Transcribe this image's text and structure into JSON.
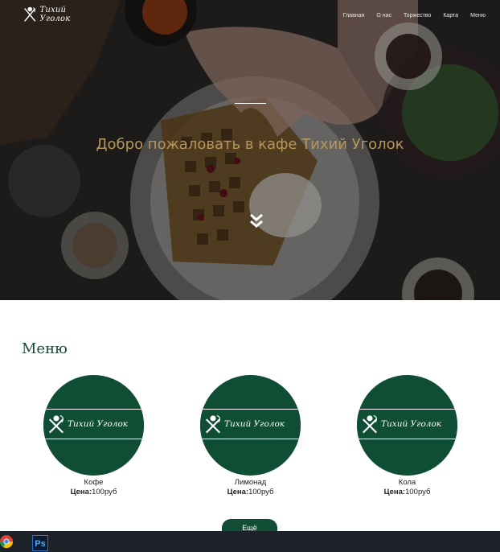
{
  "header": {
    "logo_text": "Тихий Уголок",
    "nav": [
      "Главная",
      "О нас",
      "Торжество",
      "Карта",
      "Меню"
    ]
  },
  "hero": {
    "title": "Добро пожаловать в кафе Тихий Уголок"
  },
  "menu": {
    "title": "Меню",
    "items": [
      {
        "name": "Кофе",
        "price_label": "Цена:",
        "price": "100руб",
        "logo_text": "Тихий Уголок"
      },
      {
        "name": "Лимонад",
        "price_label": "Цена:",
        "price": "100руб",
        "logo_text": "Тихий Уголок"
      },
      {
        "name": "Кола",
        "price_label": "Цена:",
        "price": "100руб",
        "logo_text": "Тихий Уголок"
      }
    ],
    "more_button": "Ещё"
  },
  "taskbar": {
    "apps": [
      "chrome-icon",
      "photoshop-icon"
    ],
    "ps_label": "Ps"
  },
  "colors": {
    "brand_green": "#0f4e35",
    "hero_title": "#b8975a"
  }
}
